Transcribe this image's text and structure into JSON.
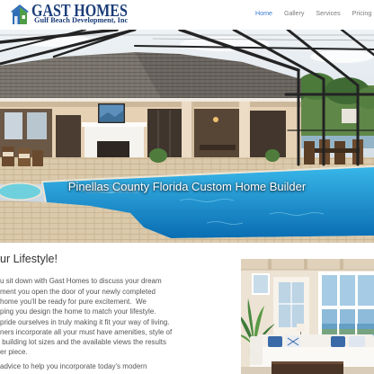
{
  "header": {
    "logo_icon": "house-icon",
    "logo_title": "GAST HOMES",
    "logo_subtitle": "Gulf Beach Development, Inc"
  },
  "nav": {
    "items": [
      {
        "label": "Home",
        "active": true
      },
      {
        "label": "Gallery",
        "active": false
      },
      {
        "label": "Services",
        "active": false
      },
      {
        "label": "Pricing",
        "active": false
      }
    ]
  },
  "hero": {
    "caption": "Pinellas County Florida Custom Home Builder"
  },
  "intro": {
    "heading": "ur Lifestyle!",
    "paragraphs": [
      [
        "u sit down with Gast Homes to discuss your dream",
        "ment you open the door of your newly completed",
        "home you'll be ready for pure excitement.  We",
        "ping you design the home to match your lifestyle.",
        "pride ourselves in truly making it fit your way of living.",
        "ners incorporate all your must have amenities, style of",
        " building lot sizes and the available views the results",
        "er piece."
      ],
      [
        "advice to help you incorporate today's modern"
      ]
    ]
  },
  "colors": {
    "brand_navy": "#1b3d78",
    "nav_active": "#3a7bd5",
    "nav_text": "#7a7a7a",
    "heading_text": "#333333",
    "body_text": "#555555"
  }
}
